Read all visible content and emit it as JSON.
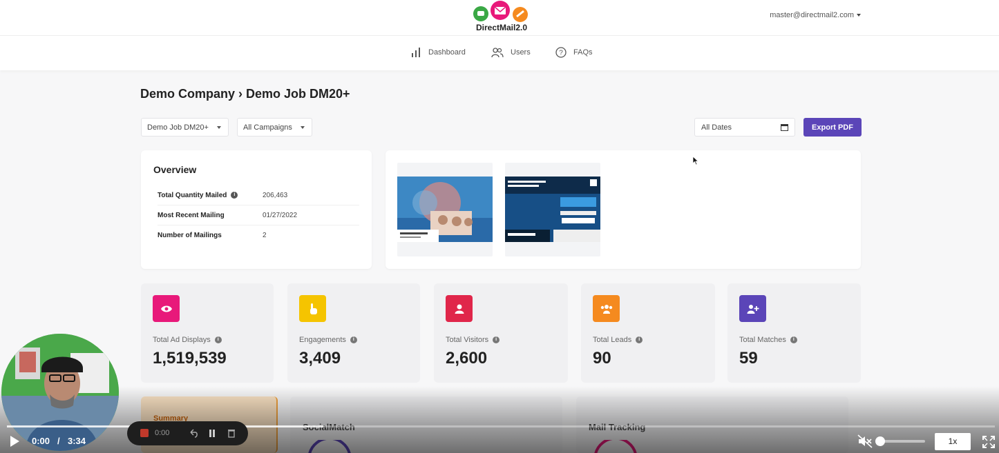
{
  "header": {
    "logo_text": "DirectMail2.0",
    "user_email": "master@directmail2.com"
  },
  "nav": {
    "items": [
      {
        "label": "Dashboard",
        "icon": "bar-chart-icon"
      },
      {
        "label": "Users",
        "icon": "users-icon"
      },
      {
        "label": "FAQs",
        "icon": "help-circle-icon"
      }
    ]
  },
  "breadcrumb": "Demo Company › Demo Job DM20+",
  "filters": {
    "job": "Demo Job DM20+",
    "campaign": "All Campaigns",
    "date_placeholder": "All Dates",
    "export_label": "Export PDF"
  },
  "overview": {
    "title": "Overview",
    "rows": [
      {
        "label": "Total Quantity Mailed",
        "value": "206,463",
        "info": true
      },
      {
        "label": "Most Recent Mailing",
        "value": "01/27/2022",
        "info": false
      },
      {
        "label": "Number of Mailings",
        "value": "2",
        "info": false
      }
    ]
  },
  "stats": [
    {
      "label": "Total Ad Displays",
      "value": "1,519,539",
      "icon": "eye-icon",
      "color": "#e8197a"
    },
    {
      "label": "Engagements",
      "value": "3,409",
      "icon": "pointer-hand-icon",
      "color": "#f5c400"
    },
    {
      "label": "Total Visitors",
      "value": "2,600",
      "icon": "user-icon",
      "color": "#e0264a"
    },
    {
      "label": "Total Leads",
      "value": "90",
      "icon": "group-icon",
      "color": "#f58a1f"
    },
    {
      "label": "Total Matches",
      "value": "59",
      "icon": "user-plus-icon",
      "color": "#5b45b8"
    }
  ],
  "lower": {
    "summary_tab": "Summary",
    "socialmatch_title": "SocialMatch",
    "mailtracking_title": "Mail Tracking"
  },
  "video": {
    "current_time": "0:00",
    "separator": "/",
    "duration": "3:34",
    "recorder_time": "0:00",
    "speed": "1x",
    "progress_buffered": 0.32
  }
}
